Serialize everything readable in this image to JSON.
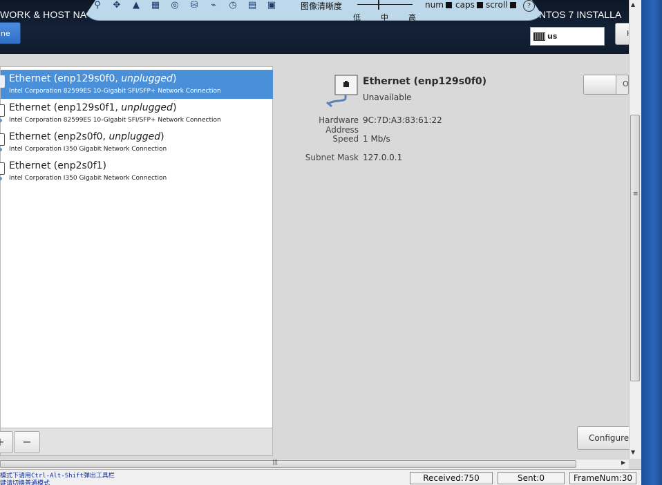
{
  "header": {
    "left_title": "WORK & HOST NA",
    "right_title": "NTOS 7 INSTALLA",
    "done_label": "ne",
    "keyboard_layout": "us",
    "help_label": "H"
  },
  "toolbar": {
    "icons": [
      "pin-icon",
      "move-icon",
      "triangle-icon",
      "calendar-icon",
      "disc-icon",
      "drive-icon",
      "usb-icon",
      "clock-icon",
      "grid-icon",
      "window-icon"
    ],
    "clarity_label": "图像清晰度",
    "slider_low": "低",
    "slider_mid": "中",
    "slider_high": "高",
    "num_label": "num",
    "caps_label": "caps",
    "scroll_label": "scroll",
    "help_symbol": "?"
  },
  "devices": [
    {
      "name": "Ethernet (enp129s0f0, ",
      "state": "unplugged",
      "suffix": ")",
      "desc": "Intel Corporation 82599ES 10-Gigabit SFI/SFP+ Network Connection",
      "selected": true
    },
    {
      "name": "Ethernet (enp129s0f1, ",
      "state": "unplugged",
      "suffix": ")",
      "desc": "Intel Corporation 82599ES 10-Gigabit SFI/SFP+ Network Connection",
      "selected": false
    },
    {
      "name": "Ethernet (enp2s0f0, ",
      "state": "unplugged",
      "suffix": ")",
      "desc": "Intel Corporation I350 Gigabit Network Connection",
      "selected": false
    },
    {
      "name": "Ethernet (enp2s0f1)",
      "state": "",
      "suffix": "",
      "desc": "Intel Corporation I350 Gigabit Network Connection",
      "selected": false
    }
  ],
  "list_controls": {
    "add_symbol": "+",
    "remove_symbol": "−"
  },
  "detail": {
    "title": "Ethernet (enp129s0f0)",
    "status": "Unavailable",
    "hw_label": "Hardware Address",
    "hw_value": "9C:7D:A3:83:61:22",
    "speed_label": "Speed",
    "speed_value": "1 Mb/s",
    "subnet_label": "Subnet Mask",
    "subnet_value": "127.0.0.1",
    "toggle_label": "O",
    "configure_label": "Configure"
  },
  "statusbar": {
    "hint_line1": "模式下请用Ctrl-Alt-Shift弹出工具栏",
    "hint_line2": "键请切换普通模式",
    "received": "Received:750",
    "sent": "Sent:0",
    "frame": "FrameNum:30"
  },
  "colors": {
    "selection": "#4a90d9",
    "header": "#142238",
    "toolbar": "#bcd8ea"
  }
}
